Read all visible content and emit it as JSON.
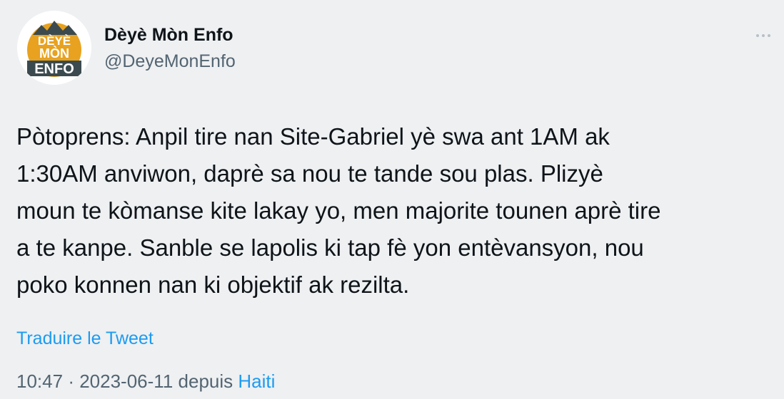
{
  "author": {
    "avatar_text": [
      "DÈYÈ",
      "MÒN",
      "ENFO"
    ],
    "display_name": "Dèyè Mòn Enfo",
    "handle": "@DeyeMonEnfo"
  },
  "tweet": {
    "text_lines": [
      "Pòtoprens: Anpil tire nan Site-Gabriel yè swa ant 1AM ak",
      "1:30AM anviwon, daprè sa nou te tande sou plas. Plizyè",
      "moun te kòmanse kite lakay yo, men majorite tounen aprè tire",
      "a te kanpe. Sanble se lapolis ki tap fè yon entèvansyon, nou",
      "poko konnen nan ki objektif ak rezilta."
    ],
    "translate_label": "Traduire le Tweet"
  },
  "meta": {
    "time": "10:47",
    "separator": "·",
    "date": "2023-06-11",
    "source_prefix": "depuis",
    "location": "Haiti"
  },
  "icons": {
    "more": "more-horizontal-icon"
  },
  "colors": {
    "background": "#eef0f2",
    "link": "#1d9bf0",
    "secondary_text": "#536471",
    "logo_orange": "#e8a21f",
    "logo_dark": "#3b4a4f"
  }
}
